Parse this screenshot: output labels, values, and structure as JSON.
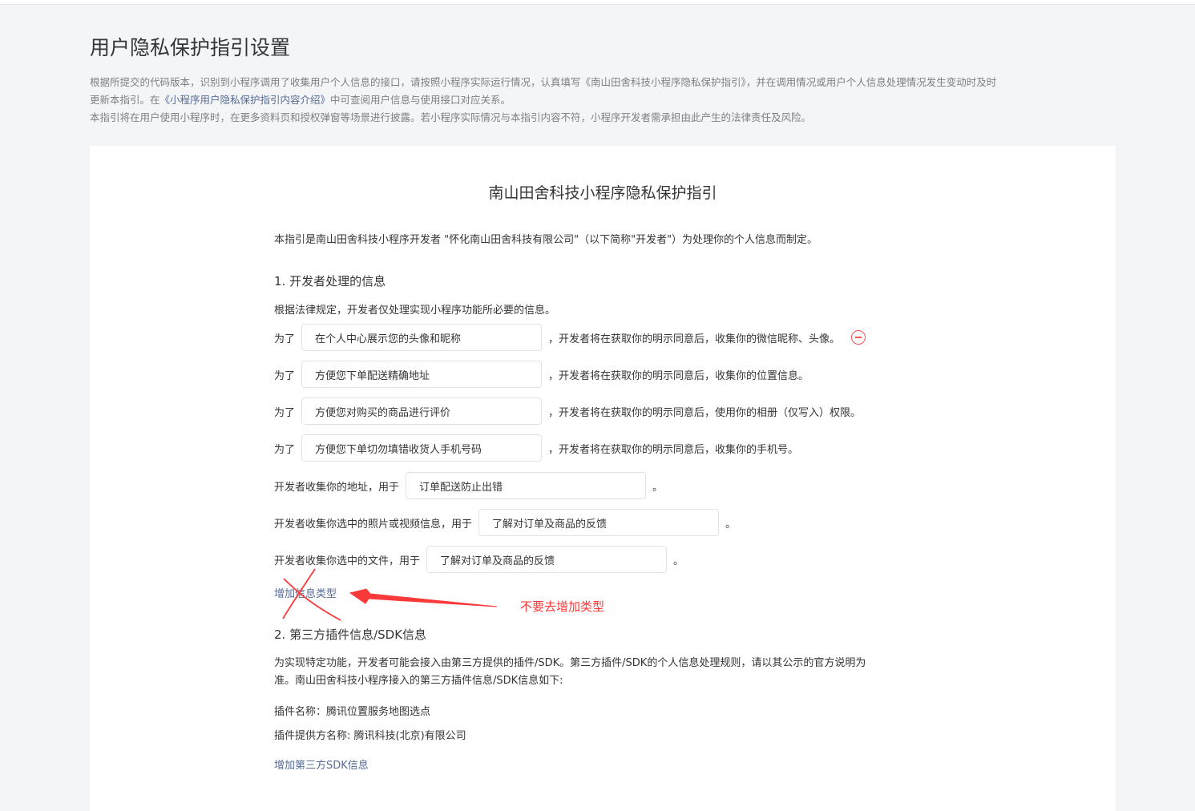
{
  "header": {
    "title": "用户隐私保护指引设置",
    "desc_line1_a": "根据所提交的代码版本，识别到小程序调用了收集用户个人信息的接口，请按照小程序实际运行情况，认真填写《南山田舍科技小程序隐私保护指引》，并在调用情况或用户个人信息处理情况发生变动时及时",
    "desc_line1_b": "更新本指引。在",
    "desc_link": "《小程序用户隐私保护指引内容介绍》",
    "desc_line1_c": "中可查阅用户信息与使用接口对应关系。",
    "desc_line2": "本指引将在用户使用小程序时，在更多资料页和授权弹窗等场景进行披露。若小程序实际情况与本指引内容不符，小程序开发者需承担由此产生的法律责任及风险。"
  },
  "doc": {
    "title": "南山田舍科技小程序隐私保护指引",
    "intro": "本指引是南山田舍科技小程序开发者 \"怀化南山田舍科技有限公司\"（以下简称\"开发者\"）为处理你的个人信息而制定。",
    "section1": {
      "heading": "1.  开发者处理的信息",
      "note": "根据法律规定，开发者仅处理实现小程序功能所必要的信息。",
      "prefix": "为了",
      "rows": [
        {
          "value": "在个人中心展示您的头像和昵称",
          "suffix": "，开发者将在获取你的明示同意后，收集你的微信昵称、头像。"
        },
        {
          "value": "方便您下单配送精确地址",
          "suffix": "，开发者将在获取你的明示同意后，收集你的位置信息。"
        },
        {
          "value": "方便您对购买的商品进行评价",
          "suffix": "，开发者将在获取你的明示同意后，使用你的相册（仅写入）权限。"
        },
        {
          "value": "方便您下单切勿填错收货人手机号码",
          "suffix": "，开发者将在获取你的明示同意后，收集你的手机号。"
        }
      ],
      "collect_rows": [
        {
          "label": "开发者收集你的地址，用于",
          "value": "订单配送防止出错",
          "end": "。"
        },
        {
          "label": "开发者收集你选中的照片或视频信息，用于",
          "value": "了解对订单及商品的反馈",
          "end": "。"
        },
        {
          "label": "开发者收集你选中的文件，用于",
          "value": "了解对订单及商品的反馈",
          "end": "。"
        }
      ],
      "add_type_link": "增加信息类型"
    },
    "section2": {
      "heading": "2.  第三方插件信息/SDK信息",
      "para_line1": "为实现特定功能，开发者可能会接入由第三方提供的插件/SDK。第三方插件/SDK的个人信息处理规则，请以其公示的官方说明为",
      "para_line2": "准。南山田舍科技小程序接入的第三方插件信息/SDK信息如下:",
      "plugin_name": "插件名称：腾讯位置服务地图选点",
      "plugin_provider": "插件提供方名称: 腾讯科技(北京)有限公司",
      "add_sdk_link": "增加第三方SDK信息"
    }
  },
  "annotation": {
    "note": "不要去增加类型",
    "color": "#fa3a3a"
  },
  "colors": {
    "link": "#576b95",
    "danger": "#fa5151",
    "background": "#f4f5f7"
  }
}
